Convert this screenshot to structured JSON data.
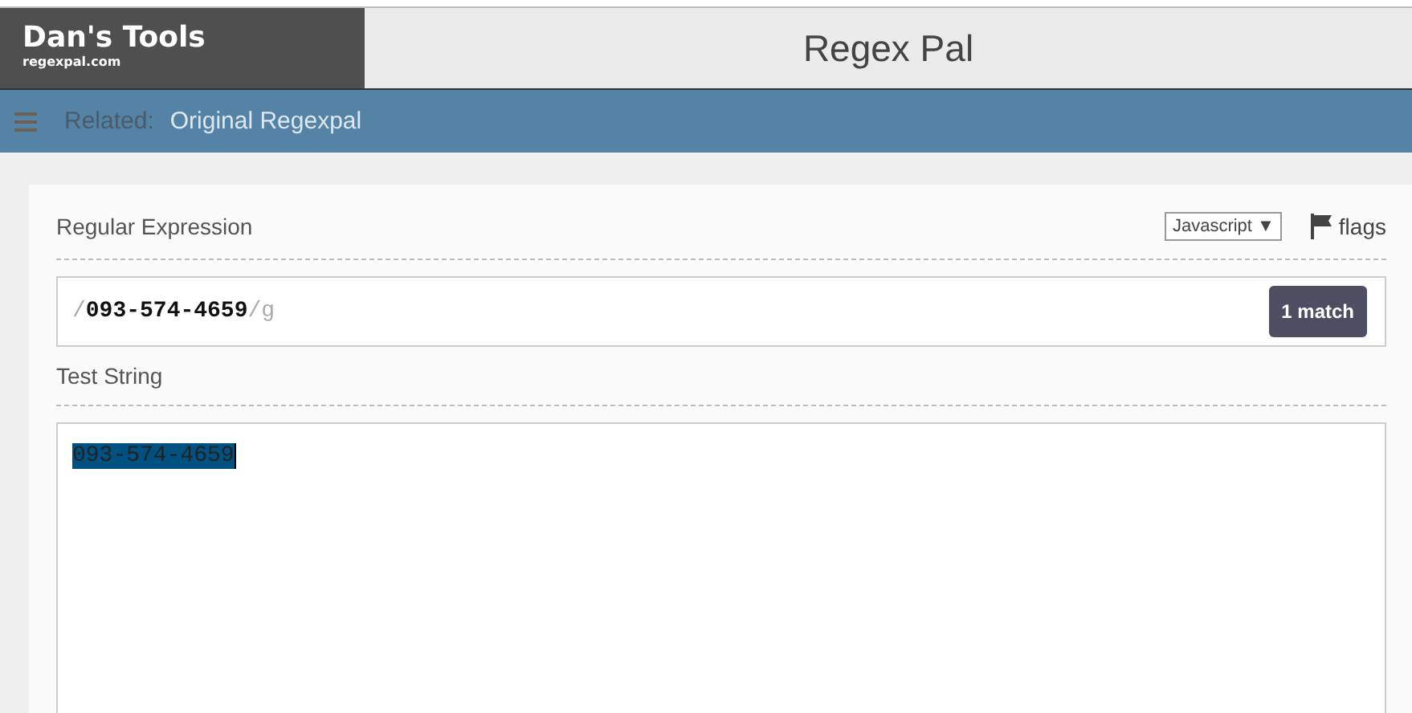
{
  "logo": {
    "title": "Dan's Tools",
    "subtitle": "regexpal.com"
  },
  "page_title": "Regex Pal",
  "related_bar": {
    "label": "Related:",
    "link": "Original Regexpal"
  },
  "regex_section": {
    "label": "Regular Expression",
    "flavor": "Javascript ▼",
    "flags_label": "flags"
  },
  "regex": {
    "open": "/",
    "pattern": "093-574-4659",
    "close": "/",
    "flags": "g",
    "match_count": "1 match"
  },
  "test_section": {
    "label": "Test String",
    "text": "093-574-4659",
    "highlighted": true
  }
}
